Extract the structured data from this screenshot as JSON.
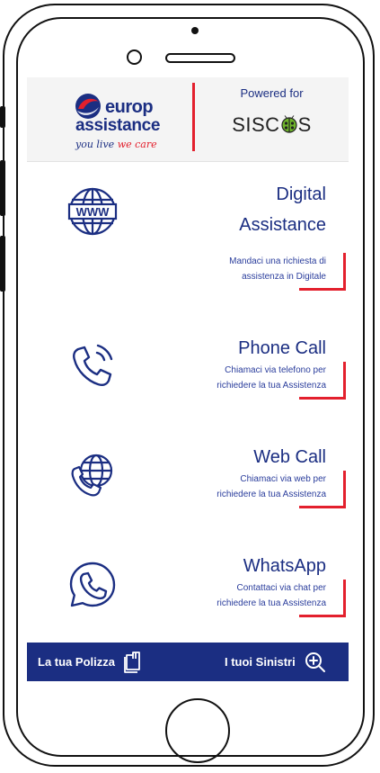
{
  "header": {
    "logo_europ": "europ",
    "logo_assistance": "assistance",
    "logo_tag_start": "you live",
    "logo_tag_end": "we care",
    "powered_label": "Powered for",
    "partner_logo": "SISC",
    "partner_logo_end": "S"
  },
  "services": [
    {
      "title_line1": "Digital",
      "title_line2": "Assistance",
      "desc_line1": "Mandaci una richiesta di",
      "desc_line2": "assistenza in Digitale",
      "icon": "www-globe-icon"
    },
    {
      "title_line1": "Phone Call",
      "desc_line1": "Chiamaci via telefono per",
      "desc_line2": "richiedere la tua Assistenza",
      "icon": "phone-call-icon"
    },
    {
      "title_line1": "Web Call",
      "desc_line1": "Chiamaci via web per",
      "desc_line2": "richiedere la tua Assistenza",
      "icon": "web-call-icon"
    },
    {
      "title_line1": "WhatsApp",
      "desc_line1": "Contattaci via chat per",
      "desc_line2": "richiedere la tua Assistenza",
      "icon": "whatsapp-icon"
    }
  ],
  "footer": {
    "policy_label": "La tua Polizza",
    "claims_label": "I tuoi Sinistri"
  },
  "colors": {
    "brand_blue": "#1b2e82",
    "accent_red": "#e3202d"
  }
}
